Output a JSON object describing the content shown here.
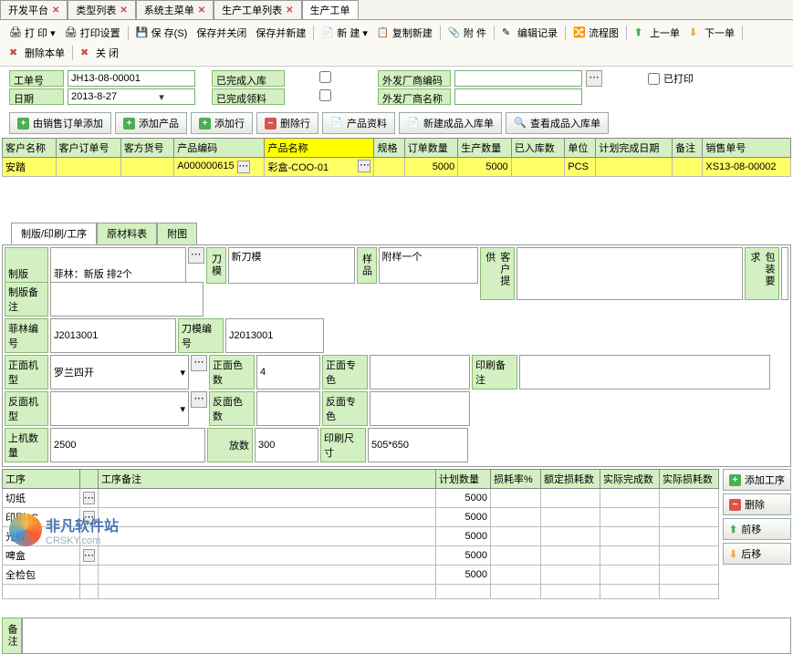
{
  "tabs": [
    "开发平台",
    "类型列表",
    "系统主菜单",
    "生产工单列表",
    "生产工单"
  ],
  "active_tab": 4,
  "toolbar": {
    "print": "打 印",
    "print_setup": "打印设置",
    "save": "保 存(S)",
    "save_close": "保存并关闭",
    "save_new": "保存并新建",
    "new": "新 建",
    "copy_new": "复制新建",
    "attach": "附 件",
    "edit_rec": "编辑记录",
    "flow": "流程图",
    "prev": "上一单",
    "next": "下一单",
    "del": "删除本单",
    "close": "关 闭"
  },
  "header": {
    "order_no_lbl": "工单号",
    "order_no": "JH13-08-00001",
    "date_lbl": "日期",
    "date": "2013-8-27",
    "done_in_lbl": "已完成入库",
    "done_in": false,
    "done_get_lbl": "已完成领料",
    "done_get": false,
    "out_code_lbl": "外发厂商编码",
    "out_code": "",
    "out_name_lbl": "外发厂商名称",
    "out_name": "",
    "printed_lbl": "已打印",
    "printed": false
  },
  "actions": {
    "add_from_sales": "由销售订单添加",
    "add_product": "添加产品",
    "add_row": "添加行",
    "del_row": "删除行",
    "prod_info": "产品资料",
    "new_in": "新建成品入库单",
    "view_in": "查看成品入库单"
  },
  "grid": {
    "cols": [
      "客户名称",
      "客户订单号",
      "客方货号",
      "产品编码",
      "产品名称",
      "规格",
      "订单数量",
      "生产数量",
      "已入库数",
      "单位",
      "计划完成日期",
      "备注",
      "销售单号"
    ],
    "row": {
      "cust": "安踏",
      "cust_order": "",
      "cust_item": "",
      "prod_code": "A000000615",
      "prod_name": "彩盒-COO-01",
      "spec": "",
      "order_qty": "5000",
      "prod_qty": "5000",
      "in_qty": "",
      "unit": "PCS",
      "plan_date": "",
      "remark": "",
      "sales_no": "XS13-08-00002"
    }
  },
  "subtabs": [
    "制版/印刷/工序",
    "原材料表",
    "附图"
  ],
  "active_subtab": 0,
  "detail": {
    "plate_lbl": "制版",
    "plate": "菲林：新版  排2个",
    "plate_remark_lbl": "制版备注",
    "plate_remark": "",
    "film_no_lbl": "菲林编号",
    "film_no": "J2013001",
    "die_lbl": "刀模",
    "die": "新刀模",
    "die_no_lbl": "刀模编号",
    "die_no": "J2013001",
    "sample_lbl": "样品",
    "sample": "附样一个",
    "cust_supply_lbl": "客户提供",
    "cust_supply": "",
    "pack_req_lbl": "包装要求",
    "pack_req": "",
    "front_mc_lbl": "正面机型",
    "front_mc": "罗兰四开",
    "front_colors_lbl": "正面色数",
    "front_colors": "4",
    "front_spot_lbl": "正面专色",
    "front_spot": "",
    "back_mc_lbl": "反面机型",
    "back_mc": "",
    "back_colors_lbl": "反面色数",
    "back_colors": "",
    "back_spot_lbl": "反面专色",
    "back_spot": "",
    "print_remark_lbl": "印刷备注",
    "print_remark": "",
    "on_mc_qty_lbl": "上机数量",
    "on_mc_qty": "2500",
    "layout_lbl": "放数",
    "layout": "300",
    "print_size_lbl": "印刷尺寸",
    "print_size": "505*650"
  },
  "proc": {
    "cols": [
      "工序",
      "",
      "工序备注",
      "计划数量",
      "损耗率%",
      "额定损耗数",
      "实际完成数",
      "实际损耗数"
    ],
    "rows": [
      {
        "name": "切纸",
        "qty": "5000"
      },
      {
        "name": "印刷4C",
        "qty": "5000"
      },
      {
        "name": "光胶",
        "qty": "5000"
      },
      {
        "name": "啤盒",
        "qty": "5000"
      },
      {
        "name": "全检包",
        "qty": "5000"
      }
    ],
    "side": {
      "add": "添加工序",
      "del": "删除",
      "up": "前移",
      "down": "后移"
    }
  },
  "remarks_lbl": "备注",
  "watermark": {
    "t1": "非凡软件站",
    "t2": "CRSKY.com"
  }
}
